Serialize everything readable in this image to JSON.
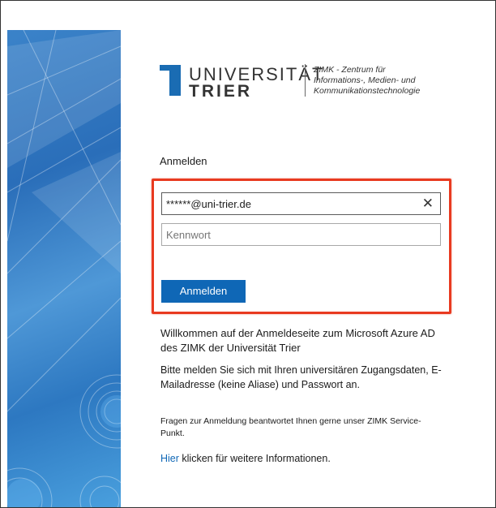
{
  "logo": {
    "university": "UNIVERSITÄT",
    "city": "TRIER",
    "subtitle_line1": "ZIMK - Zentrum für",
    "subtitle_line2": "Informations-, Medien- und",
    "subtitle_line3": "Kommunikationstechnologie"
  },
  "form": {
    "title": "Anmelden",
    "email_value": "******@uni-trier.de",
    "password_placeholder": "Kennwort",
    "clear_glyph": "✕",
    "submit_label": "Anmelden"
  },
  "info": {
    "welcome": "Willkommen auf der Anmeldeseite zum Microsoft Azure AD des ZIMK der Universität Trier",
    "instructions": "Bitte melden Sie sich mit Ihren universitären Zugangsdaten, E-Mailadresse (keine Aliase) und Passwort an.",
    "questions": "Fragen zur Anmeldung beantwortet Ihnen gerne unser ZIMK Service-Punkt.",
    "link_text": "Hier",
    "link_suffix": " klicken für weitere Informationen."
  },
  "colors": {
    "accent": "#0f67b6",
    "highlight": "#e83a20",
    "strip": "#2a6eb9"
  }
}
